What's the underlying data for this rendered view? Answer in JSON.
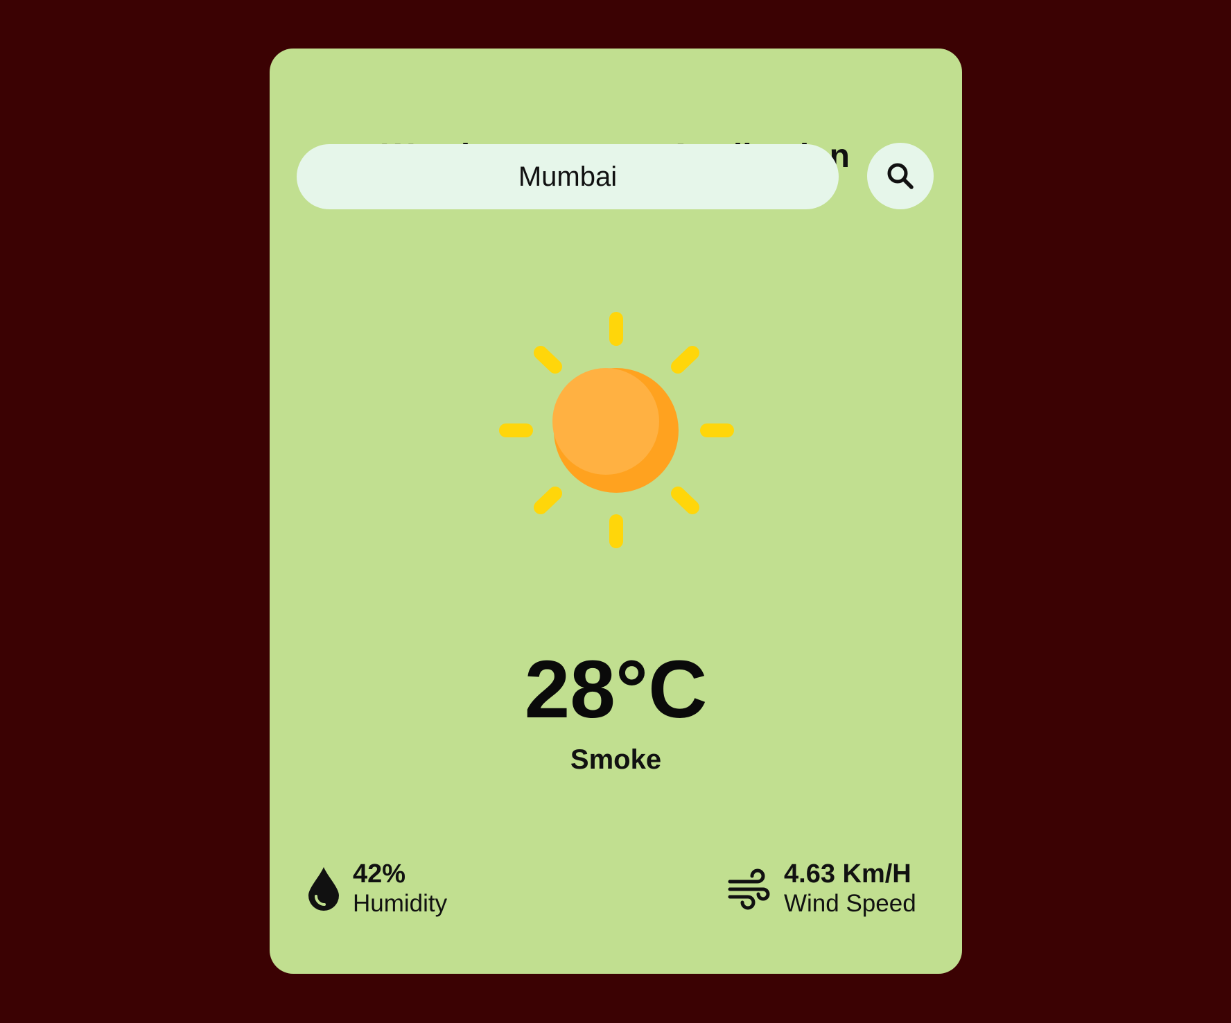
{
  "app": {
    "title": "Weather Forecast Application"
  },
  "search": {
    "value": "Mumbai",
    "button_icon": "search-icon"
  },
  "weather": {
    "icon": "sun-icon",
    "temperature": "28°C",
    "condition": "Smoke"
  },
  "details": {
    "humidity": {
      "icon": "humidity-drop-icon",
      "value": "42%",
      "label": "Humidity"
    },
    "wind": {
      "icon": "wind-icon",
      "value": "4.63 Km/H",
      "label": "Wind Speed"
    }
  },
  "colors": {
    "page_background": "#3b0203",
    "card_background": "#c1df90",
    "input_background": "#e6f6ea",
    "sun_body": "#ffb142",
    "sun_shade": "#ffa21f",
    "sun_rays": "#ffd60a"
  }
}
